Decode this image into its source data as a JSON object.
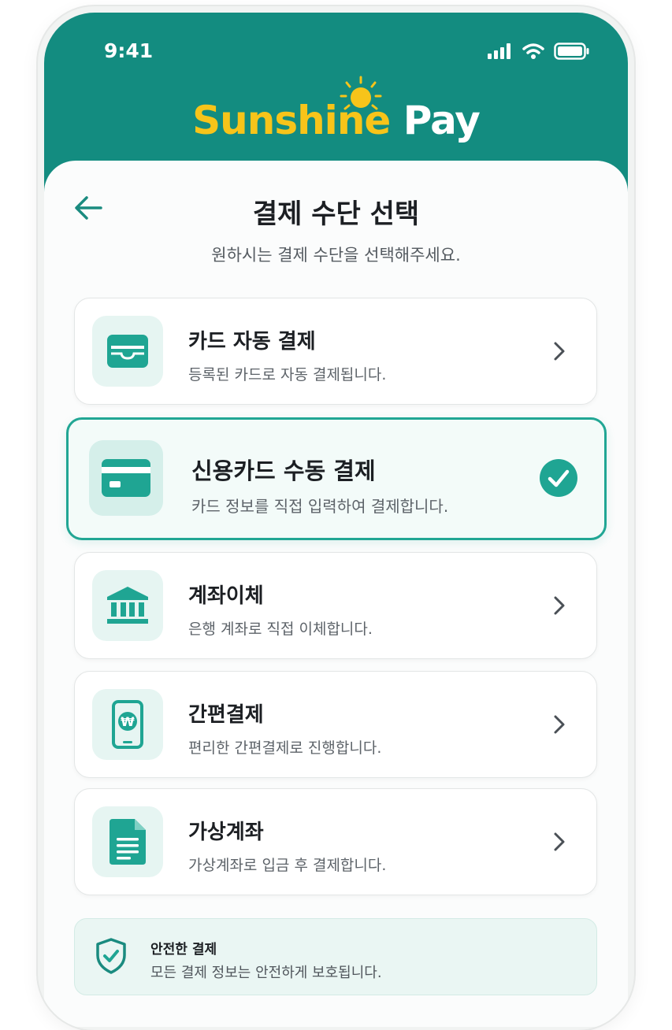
{
  "status_bar": {
    "time": "9:41"
  },
  "brand": {
    "logo_part1": "Sunshine",
    "logo_part2": "Pay"
  },
  "page": {
    "title": "결제 수단 선택",
    "subtitle": "원하시는 결제 수단을 선택해주세요."
  },
  "options": [
    {
      "title": "카드 자동 결제",
      "desc": "등록된 카드로 자동 결제됩니다.",
      "icon": "wallet-icon"
    },
    {
      "title": "신용카드 수동 결제",
      "desc": "카드 정보를 직접 입력하여 결제합니다.",
      "icon": "credit-card-icon",
      "selected": true
    },
    {
      "title": "계좌이체",
      "desc": "은행 계좌로 직접 이체합니다.",
      "icon": "bank-icon"
    },
    {
      "title": "간편결제",
      "desc": "편리한 간편결제로 진행합니다.",
      "icon": "mobile-won-icon"
    },
    {
      "title": "가상계좌",
      "desc": "가상계좌로 입금 후 결제합니다.",
      "icon": "document-icon"
    }
  ],
  "secure_notice": {
    "title": "안전한 결제",
    "desc": "모든 결제 정보는 안전하게 보호됩니다."
  },
  "colors": {
    "primary": "#138c80",
    "accent": "#21a694",
    "sun": "#f7c41a"
  }
}
